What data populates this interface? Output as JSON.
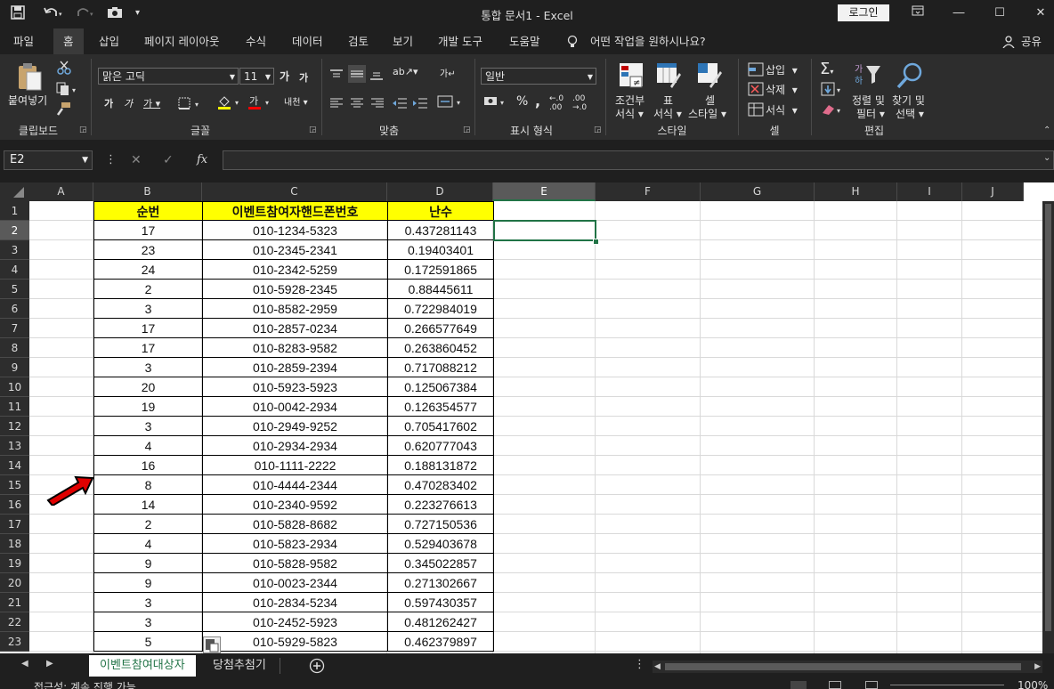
{
  "app": {
    "title": "통합 문서1  -  Excel",
    "login": "로그인",
    "quick_access": [
      "save-icon",
      "undo-icon",
      "redo-icon",
      "camera-icon",
      "customize-icon"
    ]
  },
  "menu": [
    "파일",
    "홈",
    "삽입",
    "페이지 레이아웃",
    "수식",
    "데이터",
    "검토",
    "보기",
    "개발 도구",
    "도움말"
  ],
  "tell_me": "어떤 작업을 원하시나요?",
  "share": "공유",
  "ribbon": {
    "clipboard": {
      "paste": "붙여넣기",
      "label": "클립보드"
    },
    "font": {
      "name": "맑은 고딕",
      "size": "11",
      "label": "글꼴"
    },
    "align": {
      "label": "맞춤"
    },
    "number": {
      "format": "일반",
      "label": "표시 형식"
    },
    "styles": {
      "cond1": "조건부",
      "cond2": "서식",
      "table1": "표",
      "table2": "서식",
      "cell1": "셀",
      "cell2": "스타일",
      "label": "스타일"
    },
    "cells": {
      "insert": "삽입",
      "delete": "삭제",
      "format": "서식",
      "label": "셀"
    },
    "editing": {
      "sort1": "정렬 및",
      "sort2": "필터",
      "find1": "찾기 및",
      "find2": "선택",
      "label": "편집"
    }
  },
  "formula_bar": {
    "name_box": "E2",
    "formula": ""
  },
  "columns": [
    "A",
    "B",
    "C",
    "D",
    "E",
    "F",
    "G",
    "H",
    "I",
    "J"
  ],
  "selected_cell": "E2",
  "table": {
    "headers": [
      "순번",
      "이벤트참여자핸드폰번호",
      "난수"
    ],
    "rows": [
      [
        "17",
        "010-1234-5323",
        "0.437281143"
      ],
      [
        "23",
        "010-2345-2341",
        "0.19403401"
      ],
      [
        "24",
        "010-2342-5259",
        "0.172591865"
      ],
      [
        "2",
        "010-5928-2345",
        "0.88445611"
      ],
      [
        "3",
        "010-8582-2959",
        "0.722984019"
      ],
      [
        "17",
        "010-2857-0234",
        "0.266577649"
      ],
      [
        "17",
        "010-8283-9582",
        "0.263860452"
      ],
      [
        "3",
        "010-2859-2394",
        "0.717088212"
      ],
      [
        "20",
        "010-5923-5923",
        "0.125067384"
      ],
      [
        "19",
        "010-0042-2934",
        "0.126354577"
      ],
      [
        "3",
        "010-2949-9252",
        "0.705417602"
      ],
      [
        "4",
        "010-2934-2934",
        "0.620777043"
      ],
      [
        "16",
        "010-1111-2222",
        "0.188131872"
      ],
      [
        "8",
        "010-4444-2344",
        "0.470283402"
      ],
      [
        "14",
        "010-2340-9592",
        "0.223276613"
      ],
      [
        "2",
        "010-5828-8682",
        "0.727150536"
      ],
      [
        "4",
        "010-5823-2934",
        "0.529403678"
      ],
      [
        "9",
        "010-5828-9582",
        "0.345022857"
      ],
      [
        "9",
        "010-0023-2344",
        "0.271302667"
      ],
      [
        "3",
        "010-2834-5234",
        "0.597430357"
      ],
      [
        "3",
        "010-2452-5923",
        "0.481262427"
      ],
      [
        "5",
        "010-5929-5823",
        "0.462379897"
      ]
    ]
  },
  "row_numbers": [
    "1",
    "2",
    "3",
    "4",
    "5",
    "6",
    "7",
    "8",
    "9",
    "10",
    "11",
    "12",
    "13",
    "14",
    "15",
    "16",
    "17",
    "18",
    "19",
    "20",
    "21",
    "22",
    "23"
  ],
  "sheets": [
    "이벤트참여대상자",
    "당첨추첨기"
  ],
  "status": {
    "text": "접근성: 계속 진행 가능",
    "zoom": "100%"
  }
}
